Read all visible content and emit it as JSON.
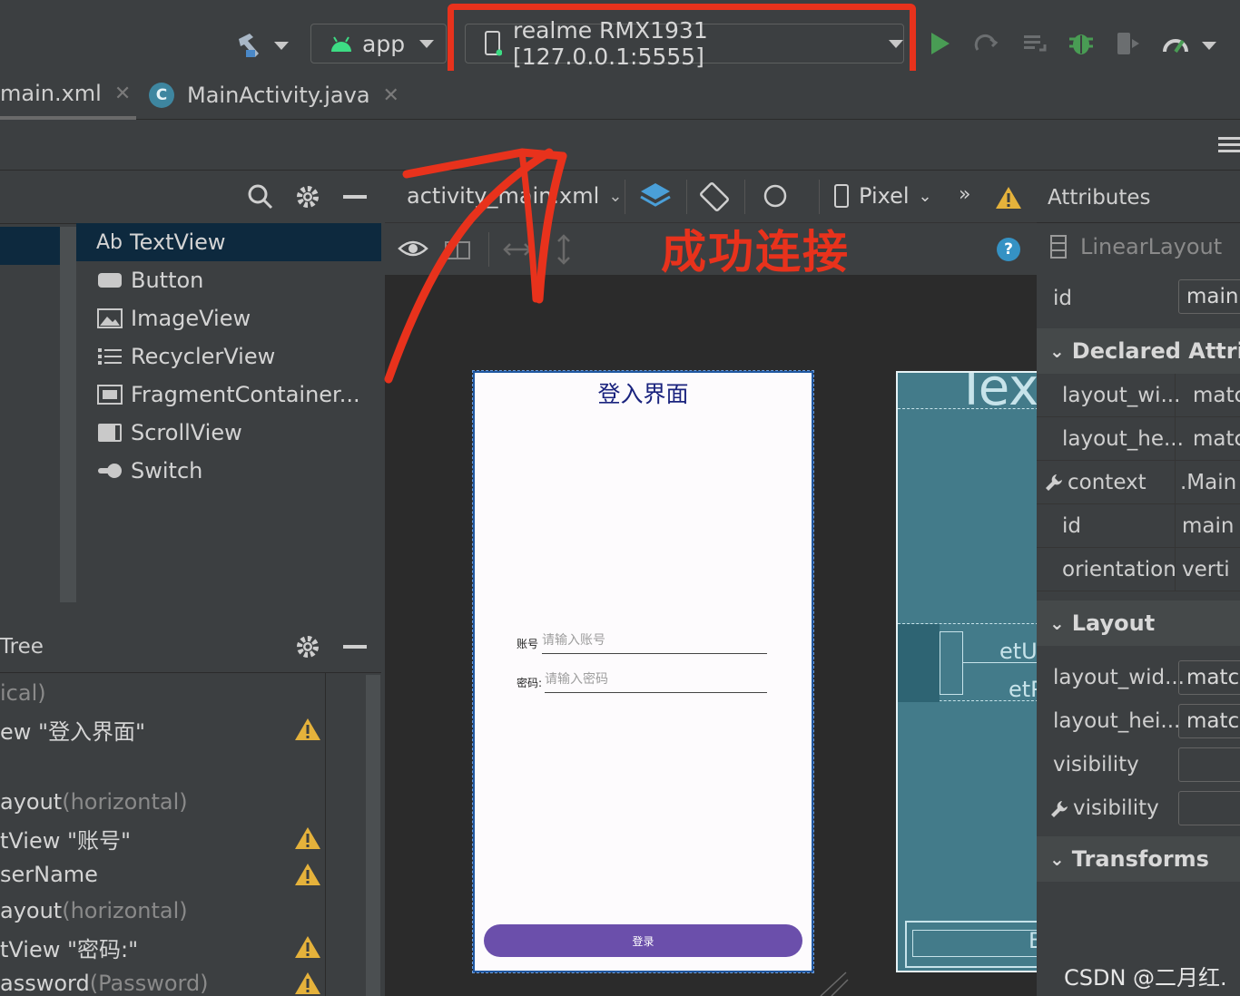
{
  "toolbar": {
    "module_label": "app",
    "device_label": "realme RMX1931 [127.0.0.1:5555]"
  },
  "tabs": [
    {
      "label": "main.xml"
    },
    {
      "label": "MainActivity.java"
    }
  ],
  "palette": {
    "items": [
      "TextView",
      "Button",
      "ImageView",
      "RecyclerView",
      "FragmentContainer...",
      "ScrollView",
      "Switch"
    ],
    "textview_prefix": "Ab"
  },
  "tree": {
    "header": "Tree",
    "rows": [
      {
        "text": "ical)",
        "muted": ""
      },
      {
        "text": "ew \"登入界面\"",
        "muted": ""
      },
      {
        "text": "ayout ",
        "muted": "(horizontal)"
      },
      {
        "text": "tView \"账号\"",
        "muted": ""
      },
      {
        "text": "serName",
        "muted": ""
      },
      {
        "text": "ayout ",
        "muted": "(horizontal)"
      },
      {
        "text": "tView \"密码:\"",
        "muted": ""
      },
      {
        "text": "assword ",
        "muted": "(Password)"
      }
    ]
  },
  "design": {
    "file_label": "activity_main.xml",
    "device_label": "Pixel",
    "more_label": "»",
    "help_label": "?"
  },
  "phone": {
    "title": "登入界面",
    "account_label": "账号",
    "account_placeholder": "请输入账号",
    "password_label": "密码:",
    "password_placeholder": "请输入密码",
    "login_button": "登录"
  },
  "blueprint": {
    "big_text": "Tex",
    "et1": "etU",
    "et2": "etP",
    "bottom": "B"
  },
  "attributes": {
    "header": "Attributes",
    "component": "LinearLayout",
    "id_label": "id",
    "id_value": "main",
    "declared_section": "Declared Attrib",
    "declared": [
      {
        "name": "layout_wi...",
        "value": "matc"
      },
      {
        "name": "layout_he...",
        "value": "matc"
      },
      {
        "name": "context",
        "value": ".Main"
      },
      {
        "name": "id",
        "value": "main"
      },
      {
        "name": "orientation",
        "value": "verti"
      }
    ],
    "layout_section": "Layout",
    "layout": [
      {
        "name": "layout_wid...",
        "value": "matc"
      },
      {
        "name": "layout_hei...",
        "value": "matc"
      },
      {
        "name": "visibility",
        "value": ""
      },
      {
        "name": "visibility",
        "value": ""
      }
    ],
    "transforms_section": "Transforms"
  },
  "annotation": {
    "text": "成功连接",
    "color": "#e8321c"
  },
  "watermark": "CSDN @二月红."
}
